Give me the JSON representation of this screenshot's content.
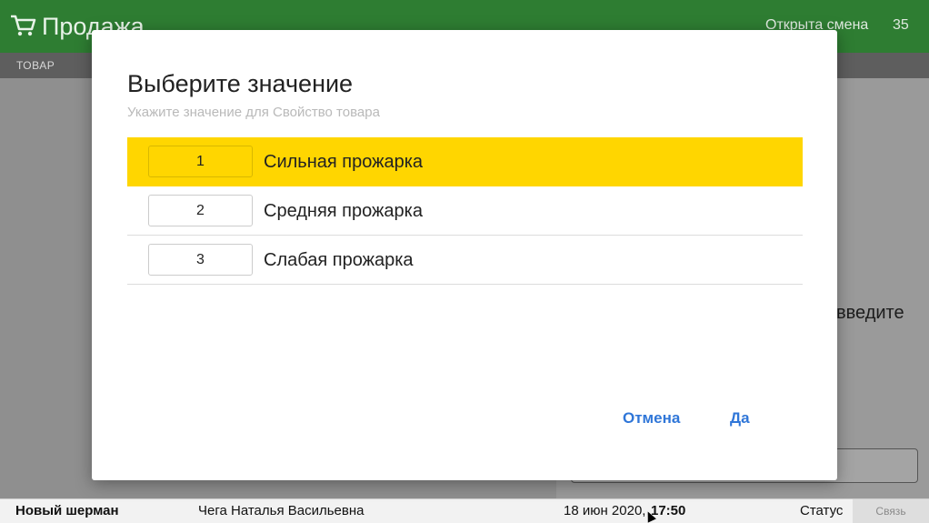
{
  "app": {
    "title": "Продажа",
    "shift_status": "Открыта смена",
    "shift_number": "35",
    "tab": "ТОВАР",
    "input_hint": "введите"
  },
  "dialog": {
    "title": "Выберите значение",
    "subtitle": "Укажите значение для Свойство товара",
    "options": [
      {
        "number": "1",
        "label": "Сильная прожарка",
        "selected": true
      },
      {
        "number": "2",
        "label": "Средняя прожарка",
        "selected": false
      },
      {
        "number": "3",
        "label": "Слабая прожарка",
        "selected": false
      }
    ],
    "cancel_label": "Отмена",
    "ok_label": "Да"
  },
  "footer": {
    "device": "Новый шерман",
    "cashier": "Чега Наталья Васильевна",
    "date": "18 июн 2020,",
    "time": "17:50",
    "status": "Статус",
    "connection": "Связь"
  },
  "colors": {
    "topbar": "#2e7d32",
    "selected": "#ffd600",
    "accent": "#2f76d8"
  },
  "icons": {
    "cart": "cart-icon",
    "cursor": "mouse-cursor-icon"
  }
}
